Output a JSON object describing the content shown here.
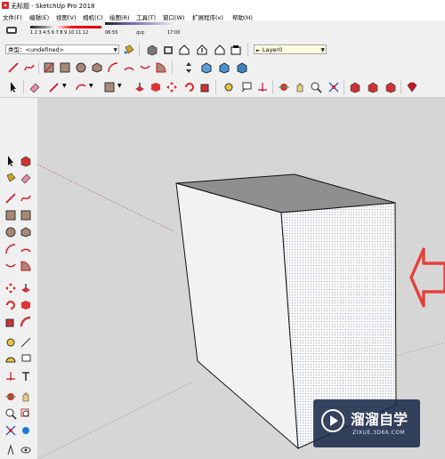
{
  "window": {
    "title": "无标题 - SketchUp Pro 2018"
  },
  "menubar": {
    "items": [
      "文件(F)",
      "编辑(E)",
      "视图(V)",
      "相机(C)",
      "绘图(R)",
      "工具(T)",
      "窗口(W)",
      "扩展程序(x)",
      "帮助(H)"
    ]
  },
  "shadow_toolbar": {
    "month_labels": "1 2 3 4 5 6 7 8 9 10 11 12",
    "time_start": "06:55",
    "time_mid": "中午",
    "time_end": "17:00"
  },
  "style_toolbar": {
    "tag_label": "类型：",
    "tag_value": "<undefined>",
    "layer_value": "Layer0"
  },
  "watermark": {
    "brand": "溜溜自学",
    "url": "ZIXUE.3D66.COM"
  },
  "colors": {
    "viewport_bg": "#d6d6d6",
    "box_top": "#8f8f8f",
    "box_front": "#f2f2f2",
    "box_side": "#fafafa",
    "arrow_red": "#e5413b",
    "watermark_bg": "#1b2a4a"
  }
}
